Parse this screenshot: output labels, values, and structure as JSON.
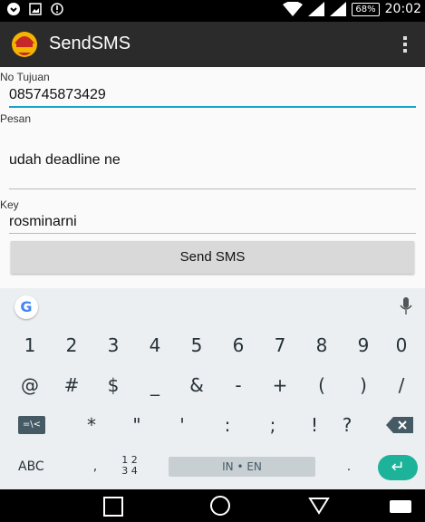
{
  "status_bar": {
    "battery": "68%",
    "time": "20:02",
    "icons": [
      "notification-icon",
      "image-icon",
      "alert-icon",
      "wifi-icon",
      "signal-icon",
      "signal-icon-2",
      "battery-icon"
    ]
  },
  "app_bar": {
    "title": "SendSMS",
    "icon": "app-logo-icon",
    "overflow_icon": "more-vert-icon"
  },
  "form": {
    "no_tujuan_label": "No Tujuan",
    "no_tujuan_value": "085745873429",
    "pesan_label": "Pesan",
    "pesan_value": "udah deadline ne",
    "key_label": "Key",
    "key_value": "rosminarni",
    "send_label": "Send SMS"
  },
  "keyboard": {
    "logo": "G",
    "mic_icon": "mic-icon",
    "row1": [
      "1",
      "2",
      "3",
      "4",
      "5",
      "6",
      "7",
      "8",
      "9",
      "0"
    ],
    "row2": [
      "@",
      "#",
      "$",
      "_",
      "&",
      "-",
      "+",
      "(",
      ")",
      "/"
    ],
    "row3_shift": "=\\<",
    "row3": [
      "*",
      "\"",
      "'",
      ":",
      ";",
      "!",
      "?"
    ],
    "backspace_icon": "backspace-icon",
    "abc": "ABC",
    "comma": ",",
    "fraction_top": "1 2",
    "fraction_bottom": "3 4",
    "space_label": "IN • EN",
    "period": ".",
    "enter_icon": "enter-icon"
  },
  "nav_bar": {
    "icons": [
      "back-square-icon",
      "home-circle-icon",
      "recent-triangle-icon",
      "keyboard-icon"
    ]
  },
  "colors": {
    "accent": "#1aa3c7",
    "enter": "#1db39a",
    "appbar": "#2b2b2b"
  }
}
